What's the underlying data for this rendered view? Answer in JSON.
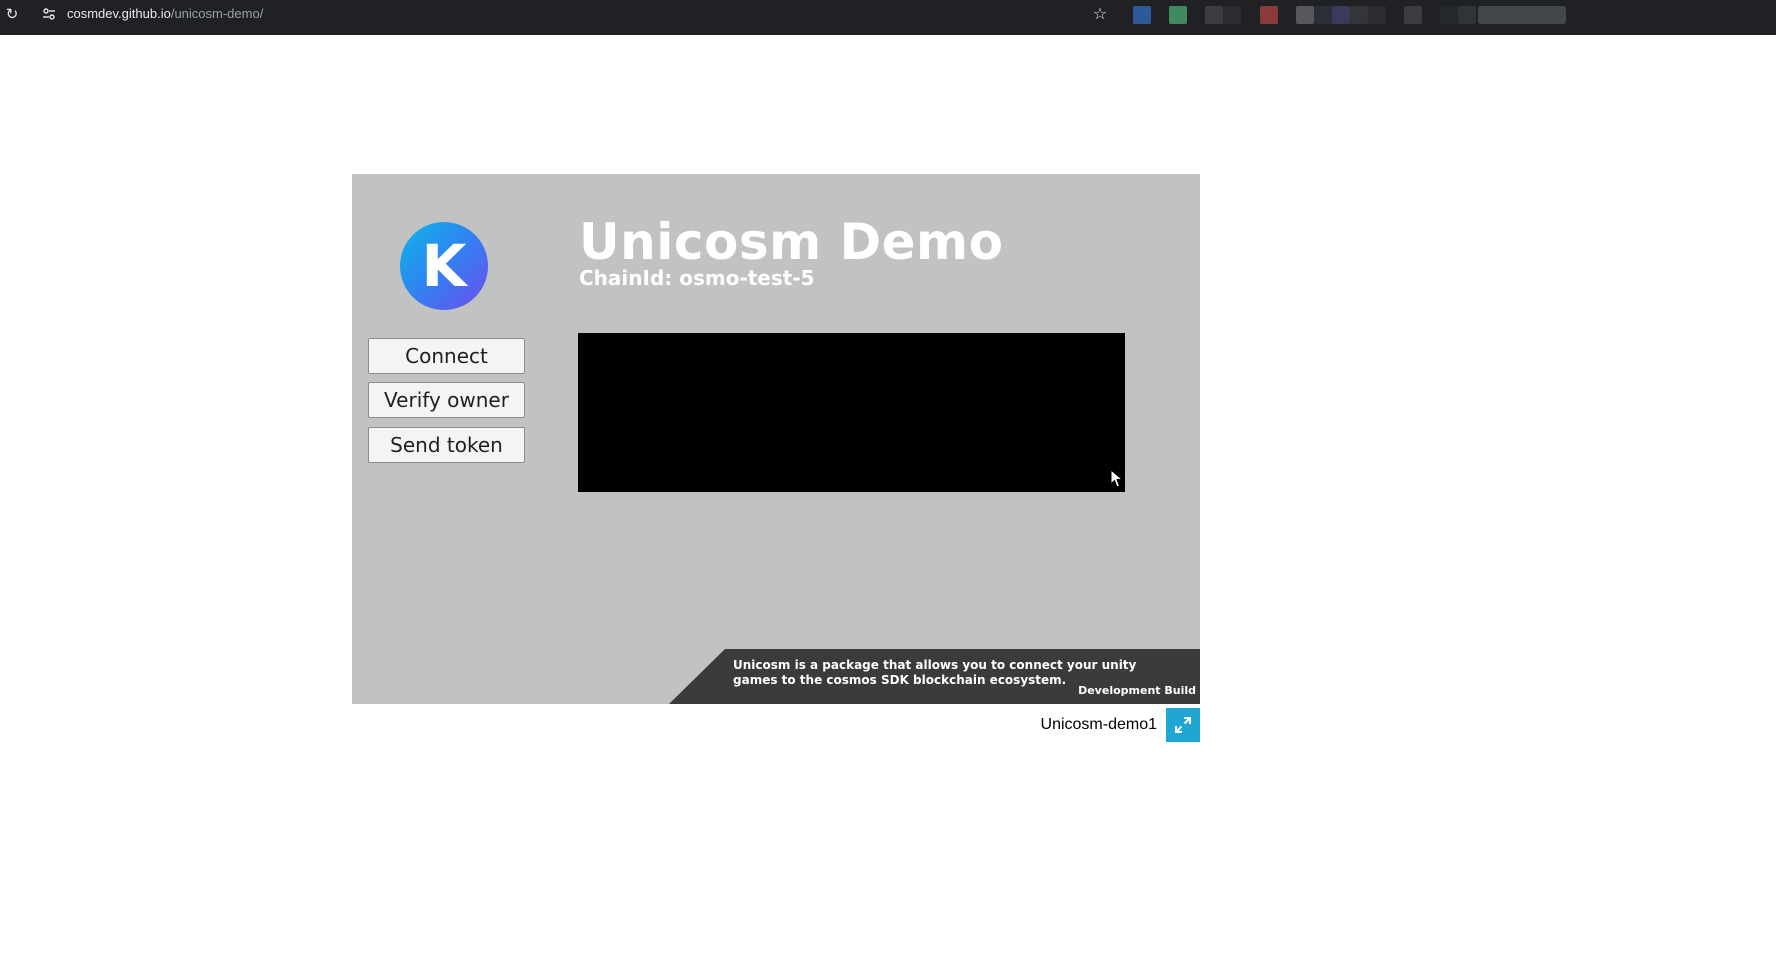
{
  "browser": {
    "url_host": "cosmdev.github.io",
    "url_path": "/unicosm-demo/",
    "reload_icon": "reload-icon",
    "site_info_icon": "tune-icon",
    "bookmark_icon": "star-icon",
    "extension_colors": [
      "#2f5a9a",
      "#3f8a5e",
      "#3b3d40",
      "#2b2d30",
      "#8b3a3a",
      "#57585b",
      "#2c2f3a",
      "#3c3a5a",
      "#33353a",
      "#2a2c2f",
      "#3a3c3f",
      "#25292b",
      "#2f3436",
      "#44474a"
    ]
  },
  "game": {
    "logo_letter": "K",
    "title": "Unicosm Demo",
    "chain_id": "ChainId: osmo-test-5",
    "buttons": {
      "connect": "Connect",
      "verify": "Verify owner",
      "send": "Send token"
    },
    "info_text": "Unicosm is a package that allows you to connect your unity games to the cosmos SDK blockchain ecosystem.",
    "dev_build": "Development Build",
    "colors": {
      "canvas_bg": "#c1c2c2",
      "panel_bg": "#000000",
      "banner_bg": "#3a3b3a",
      "logo_gradient_start": "#0fb8e8",
      "logo_gradient_end": "#6c4cf0"
    }
  },
  "footer": {
    "build_title": "Unicosm-demo1",
    "fullscreen_icon": "expand-icon",
    "fullscreen_color": "#1fa7d4"
  }
}
